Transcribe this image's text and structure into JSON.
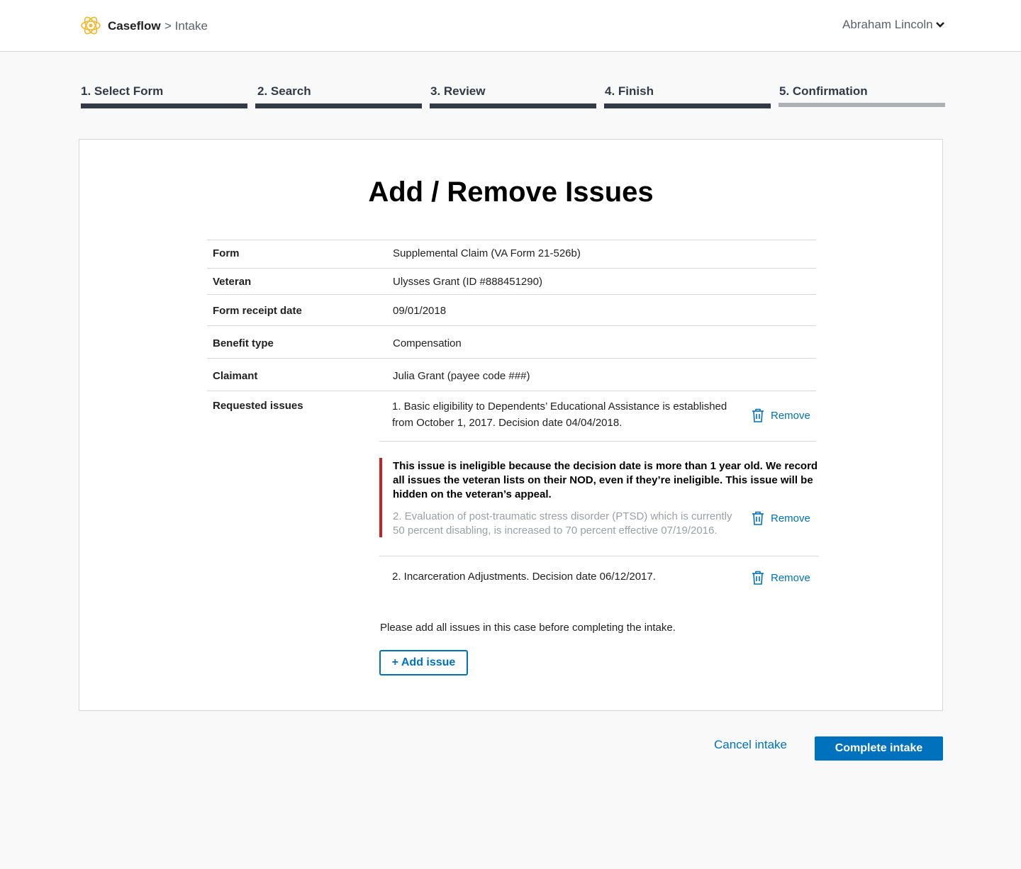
{
  "header": {
    "brand": "Caseflow",
    "breadcrumb": "> Intake",
    "user_name": "Abraham Lincoln",
    "logo_icon": "caseflow-star-logo",
    "chevron_icon": "chevron-down-icon"
  },
  "steps": [
    {
      "label": "1. Select Form",
      "state": "complete"
    },
    {
      "label": "2. Search",
      "state": "complete"
    },
    {
      "label": "3. Review",
      "state": "complete"
    },
    {
      "label": "4. Finish",
      "state": "complete"
    },
    {
      "label": "5. Confirmation",
      "state": "pending"
    }
  ],
  "page": {
    "title": "Add / Remove Issues"
  },
  "details": [
    {
      "label": "Form",
      "value": "Supplemental Claim (VA Form 21-526b)"
    },
    {
      "label": "Veteran",
      "value": "Ulysses Grant (ID #888451290)"
    },
    {
      "label": "Form receipt date",
      "value": "09/01/2018"
    },
    {
      "label": "Benefit type",
      "value": "Compensation"
    },
    {
      "label": "Claimant",
      "value": "Julia Grant (payee code ###)"
    }
  ],
  "issues": {
    "label": "Requested issues",
    "remove_label": "Remove",
    "items": [
      {
        "line1": "1. Basic eligibility to Dependents’ Educational Assistance is established",
        "line2": "from October 1, 2017. Decision date 04/04/2018."
      },
      {
        "ineligible_message": "This issue is ineligible because the decision date is more than 1 year old.  We record all issues the veteran lists on their NOD, even if they’re ineligible. This issue will be hidden on the veteran’s appeal.",
        "line1": "2. Evaluation of post-traumatic stress disorder (PTSD) which is currently",
        "line2": "50 percent disabling, is increased to 70 percent effective 07/19/2016."
      },
      {
        "line1": "2. Incarceration Adjustments. Decision date 06/12/2017."
      }
    ]
  },
  "helper_text": "Please add all issues in this case before completing the intake.",
  "add_issue_label": "+ Add issue",
  "footer": {
    "cancel_label": "Cancel intake",
    "complete_label": "Complete intake"
  },
  "colors": {
    "primary": "#0071bc",
    "error": "#cd2026",
    "step_complete": "#323a45",
    "step_pending": "#aeb0b5"
  }
}
